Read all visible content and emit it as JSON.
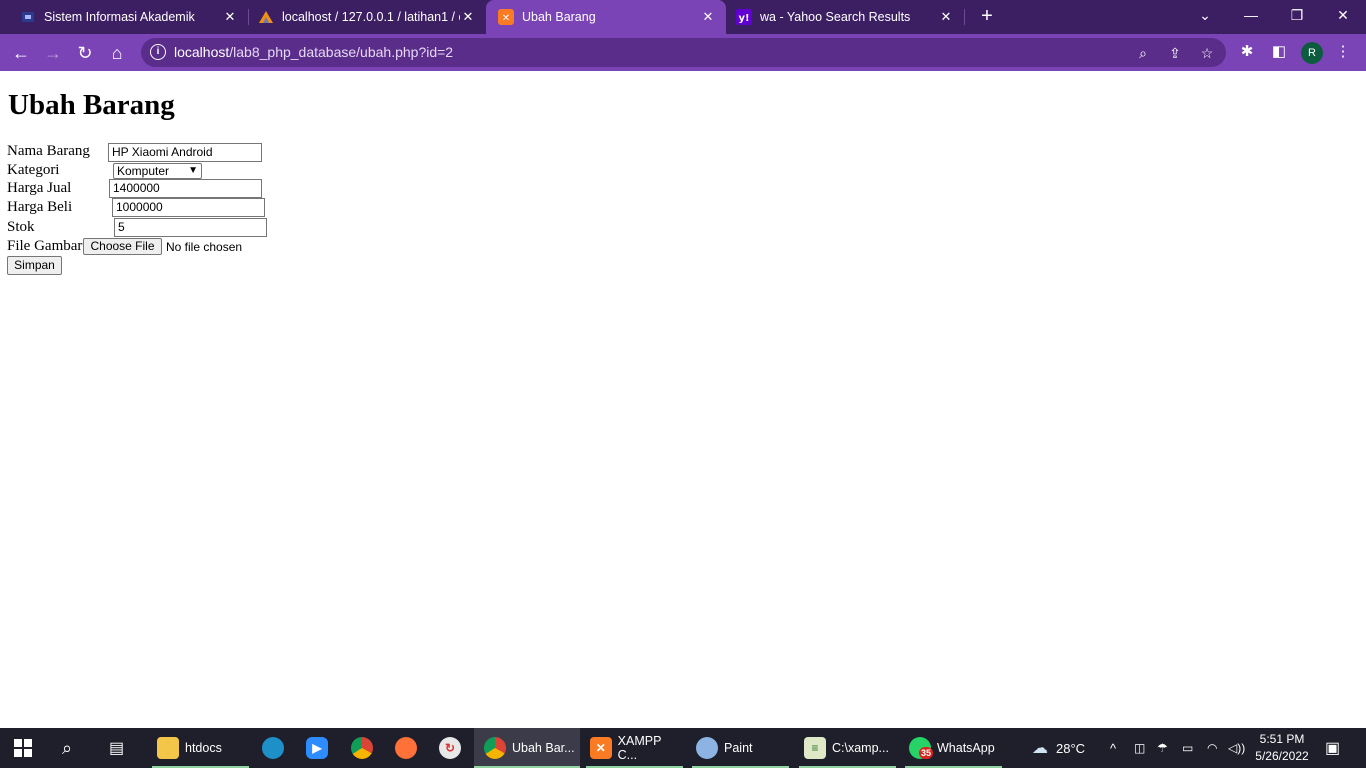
{
  "browser": {
    "tabs": [
      {
        "title": "Sistem Informasi Akademik",
        "icon": "university-logo-icon"
      },
      {
        "title": "localhost / 127.0.0.1 / latihan1 / c",
        "icon": "phpmyadmin-icon"
      },
      {
        "title": "Ubah Barang",
        "icon": "xampp-icon",
        "active": true
      },
      {
        "title": "wa - Yahoo Search Results",
        "icon": "yahoo-icon"
      }
    ],
    "url_host": "localhost",
    "url_path": "/lab8_php_database/ubah.php?id=2",
    "profile_initial": "R"
  },
  "page": {
    "heading": "Ubah Barang",
    "form": {
      "nama_label": "Nama Barang",
      "nama_value": "HP Xiaomi Android",
      "kategori_label": "Kategori",
      "kategori_value": "Komputer",
      "harga_jual_label": "Harga Jual",
      "harga_jual_value": "1400000",
      "harga_beli_label": "Harga Beli",
      "harga_beli_value": "1000000",
      "stok_label": "Stok",
      "stok_value": "5",
      "file_label": "File Gambar",
      "choose_file_label": "Choose File",
      "no_file_text": "No file chosen",
      "submit_label": "Simpan"
    }
  },
  "taskbar": {
    "items": [
      {
        "label": "htdocs",
        "icon": "folder-icon"
      },
      {
        "label": "Ubah Bar...",
        "icon": "chrome-icon"
      },
      {
        "label": "XAMPP C...",
        "icon": "xampp-icon"
      },
      {
        "label": "Paint",
        "icon": "paint-icon"
      },
      {
        "label": "C:\\xamp...",
        "icon": "notepad-icon"
      },
      {
        "label": "WhatsApp",
        "icon": "whatsapp-icon",
        "badge": "35"
      }
    ],
    "weather": "28°C",
    "time": "5:51 PM",
    "date": "5/26/2022"
  },
  "colors": {
    "tabbar": "#3c1f63",
    "toolbar": "#7a43b6",
    "taskbar": "#1f1f2b"
  }
}
